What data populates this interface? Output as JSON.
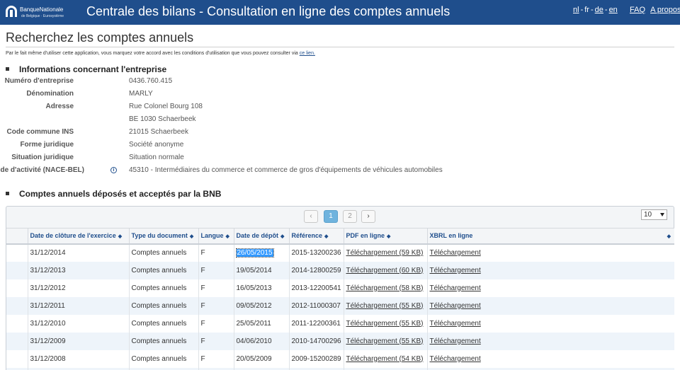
{
  "header": {
    "logo_line1": "BanqueNationale",
    "logo_line2": "de Belgique · Eurosystème",
    "title": "Centrale des bilans - Consultation en ligne des comptes annuels",
    "languages": [
      "nl",
      "fr",
      "de",
      "en"
    ],
    "faq_label": "FAQ",
    "about_label": "A propos"
  },
  "page": {
    "title": "Recherchez les comptes annuels",
    "notice_text": "Par le fait même d'utiliser cette application, vous marquez votre accord avec les conditions d'utilisation que vous pouvez consulter via",
    "notice_link": "ce lien."
  },
  "company": {
    "heading": "Informations concernant l'entreprise",
    "rows": [
      {
        "label": "Numéro d'entreprise",
        "value": "0436.760.415"
      },
      {
        "label": "Dénomination",
        "value": "MARLY"
      },
      {
        "label": "Adresse",
        "value": "Rue Colonel Bourg 108"
      },
      {
        "label": "",
        "value": "BE 1030 Schaerbeek"
      },
      {
        "label": "Code commune INS",
        "value": "21015 Schaerbeek"
      },
      {
        "label": "Forme juridique",
        "value": "Société anonyme"
      },
      {
        "label": "Situation juridique",
        "value": "Situation normale"
      },
      {
        "label": "Code d'activité (NACE-BEL)",
        "value": "45310 - Intermédiaires du commerce et commerce de gros d'équipements de véhicules automobiles"
      }
    ],
    "info_icon_glyph": "i"
  },
  "accounts": {
    "heading": "Comptes annuels déposés et acceptés par la BNB",
    "pager": {
      "prev": "‹",
      "pages": [
        "1",
        "2"
      ],
      "next": "›"
    },
    "page_size": "10",
    "columns": [
      "",
      "Date de clôture de l'exercice",
      "Type du document",
      "Langue",
      "Date de dépôt",
      "Référence",
      "PDF en ligne",
      "XBRL en ligne"
    ],
    "sort_glyph": "◆",
    "rows": [
      {
        "close": "31/12/2014",
        "type": "Comptes annuels",
        "lang": "F",
        "deposit": "26/05/2015",
        "ref": "2015-13200236",
        "pdf": "Téléchargement (59 KB)",
        "xbrl": "Téléchargement"
      },
      {
        "close": "31/12/2013",
        "type": "Comptes annuels",
        "lang": "F",
        "deposit": "19/05/2014",
        "ref": "2014-12800259",
        "pdf": "Téléchargement (60 KB)",
        "xbrl": "Téléchargement"
      },
      {
        "close": "31/12/2012",
        "type": "Comptes annuels",
        "lang": "F",
        "deposit": "16/05/2013",
        "ref": "2013-12200541",
        "pdf": "Téléchargement (58 KB)",
        "xbrl": "Téléchargement"
      },
      {
        "close": "31/12/2011",
        "type": "Comptes annuels",
        "lang": "F",
        "deposit": "09/05/2012",
        "ref": "2012-11000307",
        "pdf": "Téléchargement (55 KB)",
        "xbrl": "Téléchargement"
      },
      {
        "close": "31/12/2010",
        "type": "Comptes annuels",
        "lang": "F",
        "deposit": "25/05/2011",
        "ref": "2011-12200361",
        "pdf": "Téléchargement (55 KB)",
        "xbrl": "Téléchargement"
      },
      {
        "close": "31/12/2009",
        "type": "Comptes annuels",
        "lang": "F",
        "deposit": "04/06/2010",
        "ref": "2010-14700296",
        "pdf": "Téléchargement (55 KB)",
        "xbrl": "Téléchargement"
      },
      {
        "close": "31/12/2008",
        "type": "Comptes annuels",
        "lang": "F",
        "deposit": "20/05/2009",
        "ref": "2009-15200289",
        "pdf": "Téléchargement (54 KB)",
        "xbrl": "Téléchargement"
      },
      {
        "close": "",
        "type": "",
        "lang": "",
        "deposit": "",
        "ref": "",
        "pdf": "",
        "xbrl": ""
      }
    ]
  },
  "colors": {
    "header_bg": "#1f4e8c",
    "link": "#1f4e8c",
    "row_alt": "#eef4fa",
    "pager_active": "#6fb3de"
  }
}
